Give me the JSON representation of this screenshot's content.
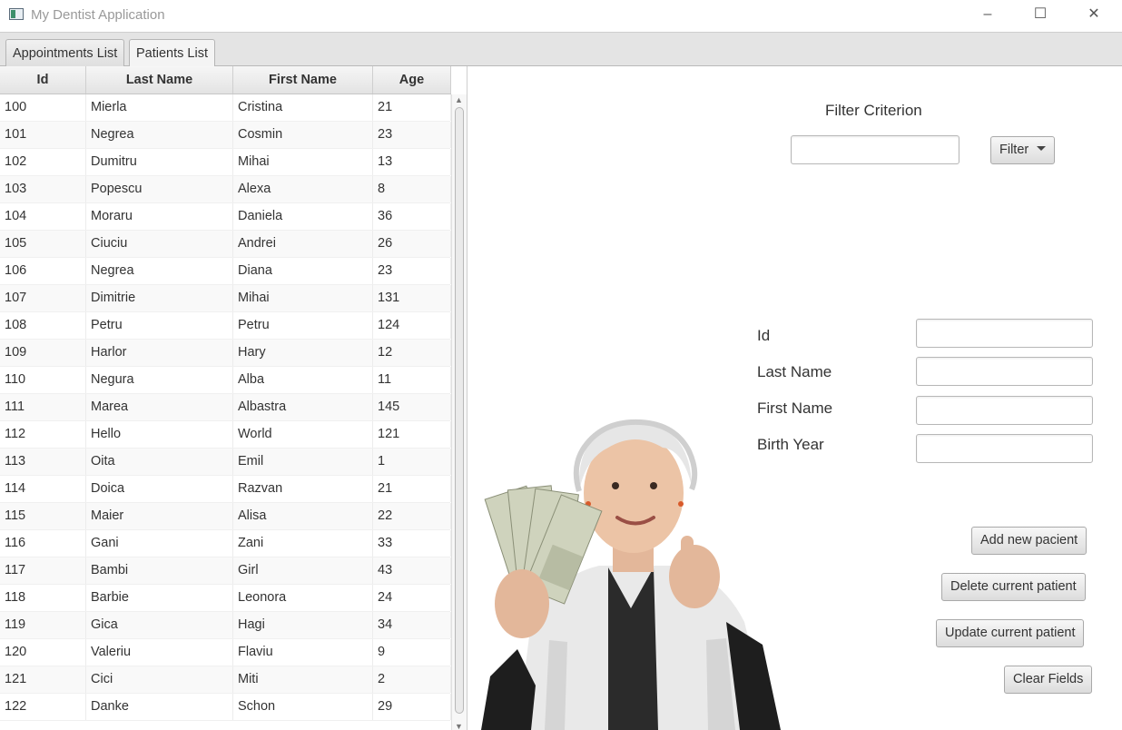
{
  "window": {
    "title": "My Dentist Application",
    "controls": {
      "minimize": "–",
      "maximize": "☐",
      "close": "✕"
    }
  },
  "tabs": [
    {
      "label": "Appointments List",
      "active": false
    },
    {
      "label": "Patients List",
      "active": true
    }
  ],
  "table": {
    "columns": [
      "Id",
      "Last Name",
      "First Name",
      "Age"
    ],
    "rows": [
      [
        "100",
        "Mierla",
        "Cristina",
        "21"
      ],
      [
        "101",
        "Negrea",
        "Cosmin",
        "23"
      ],
      [
        "102",
        "Dumitru",
        "Mihai",
        "13"
      ],
      [
        "103",
        "Popescu",
        "Alexa",
        "8"
      ],
      [
        "104",
        "Moraru",
        "Daniela",
        "36"
      ],
      [
        "105",
        "Ciuciu",
        "Andrei",
        "26"
      ],
      [
        "106",
        "Negrea",
        "Diana",
        "23"
      ],
      [
        "107",
        "Dimitrie",
        "Mihai",
        "131"
      ],
      [
        "108",
        "Petru",
        "Petru",
        "124"
      ],
      [
        "109",
        "Harlor",
        "Hary",
        "12"
      ],
      [
        "110",
        "Negura",
        "Alba",
        "11"
      ],
      [
        "111",
        "Marea",
        "Albastra",
        "145"
      ],
      [
        "112",
        "Hello",
        "World",
        "121"
      ],
      [
        "113",
        "Oita",
        "Emil",
        "1"
      ],
      [
        "114",
        "Doica",
        "Razvan",
        "21"
      ],
      [
        "115",
        "Maier",
        "Alisa",
        "22"
      ],
      [
        "116",
        "Gani",
        "Zani",
        "33"
      ],
      [
        "117",
        "Bambi",
        "Girl",
        "43"
      ],
      [
        "118",
        "Barbie",
        "Leonora",
        "24"
      ],
      [
        "119",
        "Gica",
        "Hagi",
        "34"
      ],
      [
        "120",
        "Valeriu",
        "Flaviu",
        "9"
      ],
      [
        "121",
        "Cici",
        "Miti",
        "2"
      ],
      [
        "122",
        "Danke",
        "Schon",
        "29"
      ]
    ]
  },
  "filter": {
    "title": "Filter Criterion",
    "input_value": "",
    "button_label": "Filter"
  },
  "form": {
    "id_label": "Id",
    "last_name_label": "Last Name",
    "first_name_label": "First Name",
    "birth_year_label": "Birth Year",
    "id_value": "",
    "last_name_value": "",
    "first_name_value": "",
    "birth_year_value": ""
  },
  "actions": {
    "add": "Add new pacient",
    "delete": "Delete current patient",
    "update": "Update current patient",
    "clear": "Clear Fields"
  },
  "illustration": "elderly woman holding dollar bills giving thumbs up"
}
